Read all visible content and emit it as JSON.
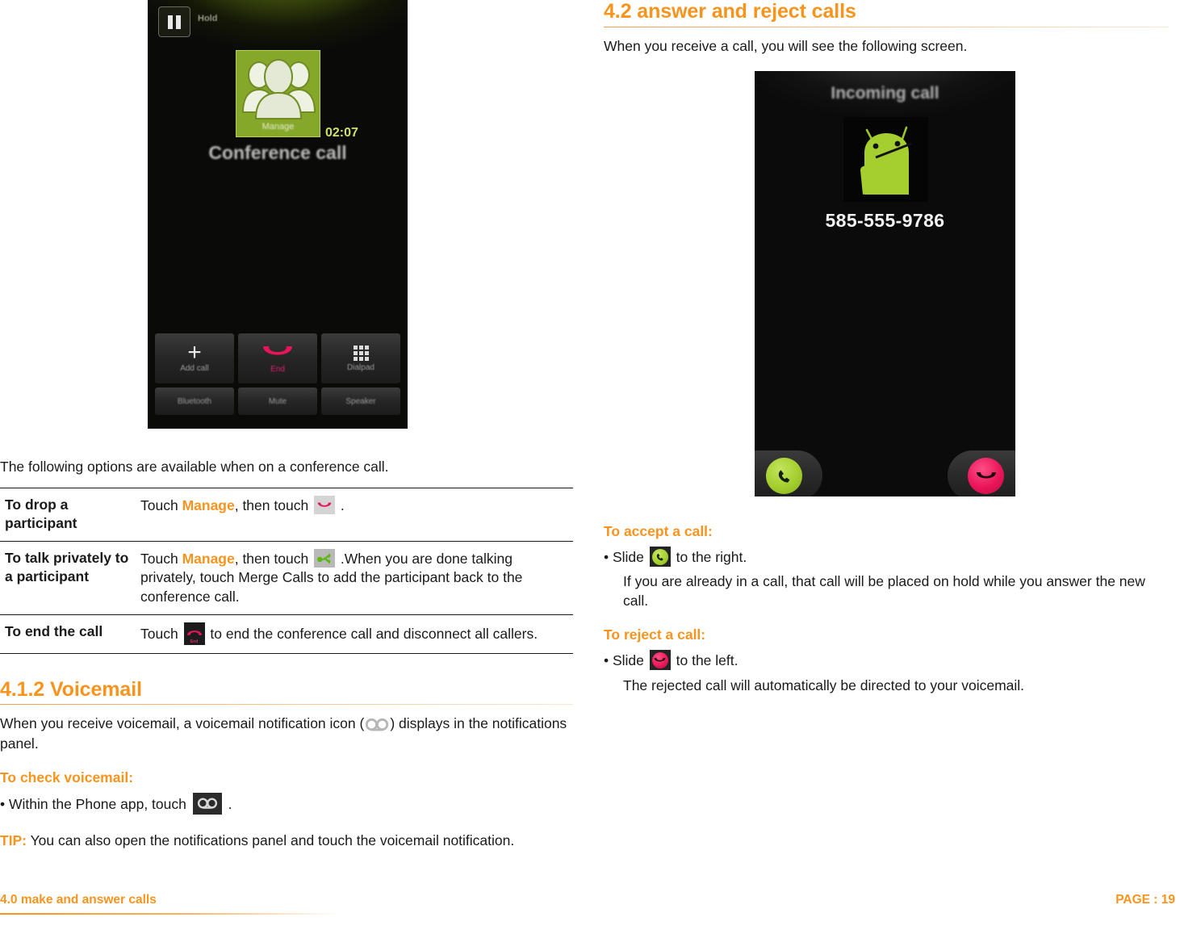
{
  "left": {
    "conference_screenshot": {
      "name": "conference-call-screen",
      "hold_label": "Hold",
      "manage_label": "Manage",
      "timer": "02:07",
      "title": "Conference call",
      "buttons": [
        {
          "label": "Add call",
          "icon": "plus-icon"
        },
        {
          "label": "End",
          "icon": "end-call-icon"
        },
        {
          "label": "Dialpad",
          "icon": "dialpad-icon"
        },
        {
          "label": "Bluetooth",
          "icon": "bluetooth-icon"
        },
        {
          "label": "Mute",
          "icon": "mute-icon"
        },
        {
          "label": "Speaker",
          "icon": "speaker-icon"
        }
      ]
    },
    "intro": "The following options are available when on a conference call.",
    "table": {
      "rows": [
        {
          "term": "To drop a participant",
          "desc_pre": "Touch ",
          "link": "Manage",
          "desc_mid": ", then touch ",
          "icon": "drop-participant-icon",
          "desc_post": " ."
        },
        {
          "term": "To talk privately to a participant",
          "desc_pre": "Touch ",
          "link": "Manage",
          "desc_mid": ", then touch ",
          "icon": "split-call-icon",
          "desc_post": " .When you are done talking privately, touch Merge Calls to add the participant back to the conference call."
        },
        {
          "term": "To end the call",
          "desc_pre": "Touch ",
          "icon": "end-call-icon",
          "desc_post": " to end the conference call and disconnect all callers."
        }
      ]
    },
    "voicemail": {
      "heading": "4.1.2 Voicemail",
      "para_pre": "When you receive voicemail, a voicemail notification icon  (",
      "para_post": ") displays in the notifications panel.",
      "sub_heading": "To check voicemail:",
      "bullet_pre": "• Within the Phone app, touch ",
      "bullet_post": " .",
      "tip_label": "TIP:",
      "tip_text": " You can also open the notifications panel and touch the voicemail notification."
    }
  },
  "right": {
    "heading": "4.2 answer and reject calls",
    "intro": "When you receive a call, you will see the following screen.",
    "incoming_screenshot": {
      "name": "incoming-call-screen",
      "title": "Incoming call",
      "caller_number": "585-555-9786",
      "accept_handle": "answer-slider-handle",
      "reject_handle": "reject-slider-handle"
    },
    "accept": {
      "heading": "To accept a call:",
      "bullet_pre": "• Slide ",
      "bullet_post": " to the right.",
      "note": "If you are already in a call, that call will be placed on hold while you answer the new call."
    },
    "reject": {
      "heading": "To reject a call:",
      "bullet_pre": "• Slide ",
      "bullet_post": " to the left.",
      "note": "The rejected call will automatically be directed to your voicemail."
    }
  },
  "footer": {
    "left": "4.0 make and answer calls",
    "right": "PAGE : 19"
  },
  "colors": {
    "accent_orange": "#F7941E",
    "android_green": "#A4CF2E",
    "end_call_pink": "#EA1559",
    "text": "#1A1A1A"
  }
}
